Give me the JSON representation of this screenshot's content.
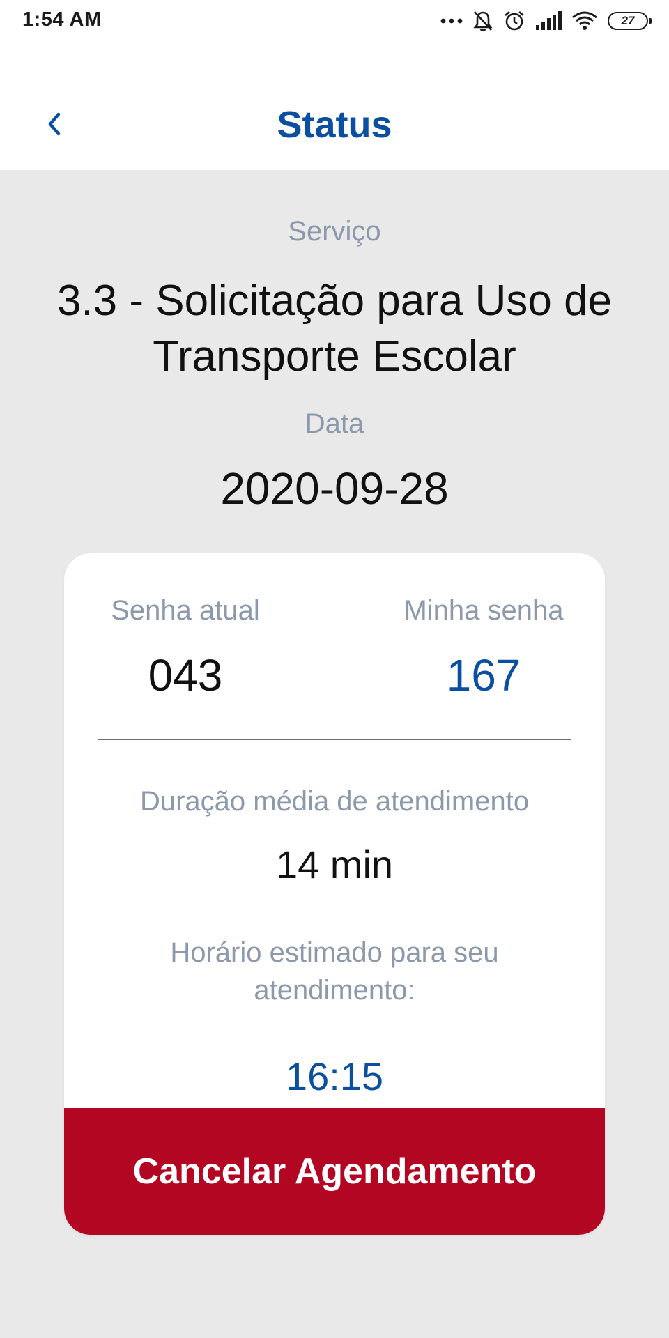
{
  "status_bar": {
    "time": "1:54 AM",
    "battery_level": "27",
    "icons": [
      "more-dots-icon",
      "bell-muted-icon",
      "alarm-icon",
      "signal-icon",
      "wifi-icon",
      "battery-icon"
    ]
  },
  "header": {
    "title": "Status",
    "back_icon": "chevron-left-icon"
  },
  "service": {
    "label": "Serviço",
    "name": "3.3 - Solicitação para Uso de Transporte Escolar"
  },
  "date": {
    "label": "Data",
    "value": "2020-09-28"
  },
  "card": {
    "current_ticket_label": "Senha atual",
    "current_ticket_value": "043",
    "my_ticket_label": "Minha senha",
    "my_ticket_value": "167",
    "avg_duration_label": "Duração média de atendimento",
    "avg_duration_value": "14 min",
    "eta_label": "Horário estimado para seu atendimento:",
    "eta_value": "16:15",
    "cancel_label": "Cancelar Agendamento"
  },
  "colors": {
    "primary_blue": "#0b4fa1",
    "muted_label": "#8b99ab",
    "danger_red": "#b30623",
    "background": "#e9e9ea"
  }
}
